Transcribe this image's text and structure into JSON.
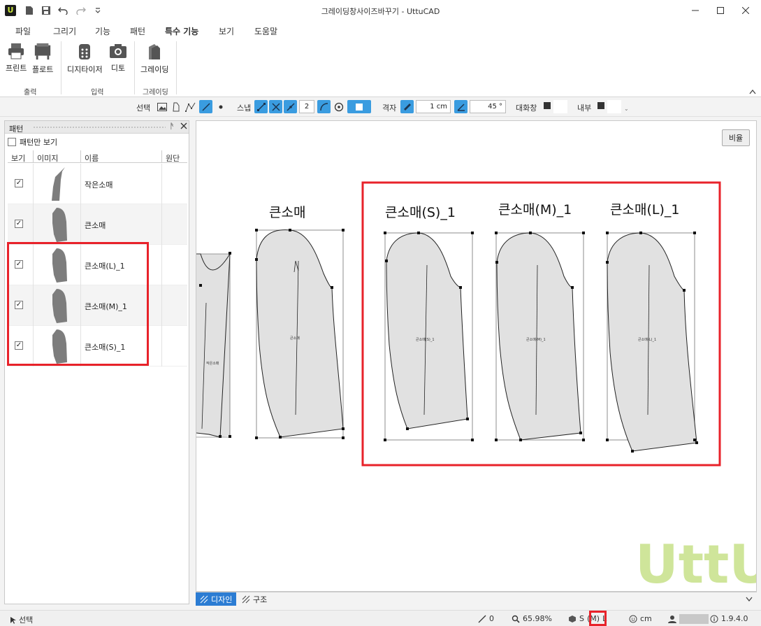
{
  "window": {
    "title": "그레이딩창사이즈바꾸기 - UttuCAD"
  },
  "menu": {
    "tabs": [
      "파일",
      "그리기",
      "기능",
      "패턴",
      "특수 기능",
      "보기",
      "도움말"
    ],
    "active_index": 4
  },
  "ribbon": {
    "buttons": [
      {
        "label": "프린트",
        "icon": "printer-icon"
      },
      {
        "label": "플로트",
        "icon": "plotter-icon"
      },
      {
        "label": "디지타이저",
        "icon": "digitizer-icon"
      },
      {
        "label": "디토",
        "icon": "camera-icon"
      },
      {
        "label": "그레이딩",
        "icon": "grading-icon"
      }
    ],
    "groups": [
      "출력",
      "입력",
      "그레이딩"
    ]
  },
  "toolbar": {
    "select_label": "선택",
    "snap_label": "스냅",
    "snap_value": "2",
    "grid_label": "격자",
    "grid_value": "1 cm",
    "angle_value": "45 °",
    "dialog_label": "대화창",
    "inner_label": "내부"
  },
  "panel": {
    "title": "패턴",
    "pattern_only_label": "패턴만 보기",
    "columns": [
      "보기",
      "이미지",
      "이름",
      "원단"
    ],
    "rows": [
      {
        "name": "작은소매",
        "checked": true
      },
      {
        "name": "큰소매",
        "checked": true
      },
      {
        "name": "큰소매(L)_1",
        "checked": true
      },
      {
        "name": "큰소매(M)_1",
        "checked": true
      },
      {
        "name": "큰소매(S)_1",
        "checked": true
      }
    ]
  },
  "canvas": {
    "ratio_button": "비율",
    "labels": {
      "big_sleeve": "큰소매",
      "s": "큰소매(S)_1",
      "m": "큰소매(M)_1",
      "l": "큰소매(L)_1"
    },
    "small_labels": {
      "small_sleeve": "작은소매",
      "big_sleeve": "큰소매",
      "s": "큰소매(S)_1",
      "m": "큰소매(M)_1",
      "l": "큰소매(L)_1"
    },
    "watermark": "UttU"
  },
  "bottom_tabs": {
    "design": "디자인",
    "structure": "구조"
  },
  "status": {
    "mode": "선택",
    "line_count": "0",
    "zoom": "65.98%",
    "size_s": "S",
    "size_m": "(M)",
    "size_l": "L",
    "unit": "cm",
    "version": "1.9.4.0"
  },
  "colors": {
    "accent": "#2b7cd3",
    "highlight": "#e8222a",
    "piece_fill": "#e1e1e1",
    "thumb_fill": "#7d7d7d",
    "watermark": "#cfe59a"
  }
}
